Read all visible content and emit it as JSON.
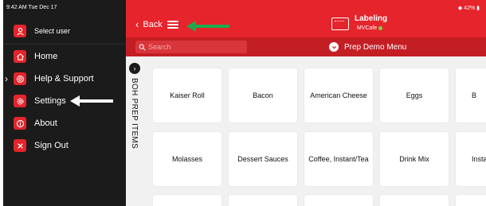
{
  "status": {
    "time_date": "9:42 AM  Tue Dec 17",
    "battery": "42%"
  },
  "sidebar": {
    "user_label": "Select user",
    "items": [
      {
        "label": "Home",
        "icon": "home-icon"
      },
      {
        "label": "Help & Support",
        "icon": "lifebuoy-icon"
      },
      {
        "label": "Settings",
        "icon": "gear-icon"
      },
      {
        "label": "About",
        "icon": "info-icon"
      },
      {
        "label": "Sign Out",
        "icon": "close-icon"
      }
    ]
  },
  "header": {
    "back_label": "Back",
    "app_title": "Labeling",
    "location": "MVCafe"
  },
  "toolbar": {
    "search_placeholder": "Search",
    "menu_name": "Prep Demo Menu"
  },
  "category": {
    "label": "BOH PREP ITEMS"
  },
  "items": [
    "Kaiser Roll",
    "Bacon",
    "American Cheese",
    "Eggs",
    "B",
    "Molasses",
    "Dessert Sauces",
    "Coffee, Instant/Tea",
    "Drink Mix",
    "Instant"
  ],
  "colors": {
    "brand": "#e5242b",
    "brand_dark": "#c41e25",
    "sidebar": "#1b1b1b",
    "annotation": "#1faa4d"
  }
}
